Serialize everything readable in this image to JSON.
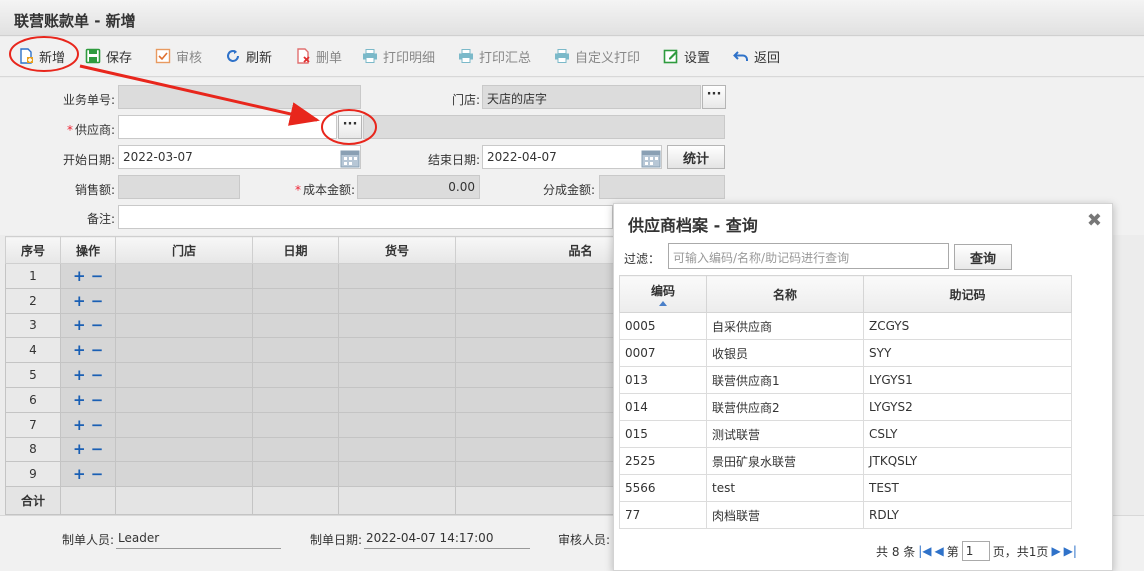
{
  "page": {
    "title": "联营账款单 - 新增"
  },
  "toolbar": {
    "new": "新增",
    "save": "保存",
    "review": "审核",
    "refresh": "刷新",
    "delete": "删单",
    "print_detail": "打印明细",
    "print_summary": "打印汇总",
    "custom_print": "自定义打印",
    "settings": "设置",
    "back": "返回"
  },
  "form": {
    "doc_no_label": "业务单号:",
    "store_label": "门店:",
    "store_value": "天店的店字",
    "supplier_label": "供应商:",
    "start_date_label": "开始日期:",
    "start_date_value": "2022-03-07",
    "end_date_label": "结束日期:",
    "end_date_value": "2022-04-07",
    "stat_button": "统计",
    "sales_label": "销售额:",
    "cost_label": "成本金额:",
    "cost_value": "0.00",
    "share_label": "分成金额:",
    "remark_label": "备注:",
    "dots": "···"
  },
  "grid": {
    "columns": [
      "序号",
      "操作",
      "门店",
      "日期",
      "货号",
      "品名"
    ],
    "rows": [
      "1",
      "2",
      "3",
      "4",
      "5",
      "6",
      "7",
      "8",
      "9"
    ],
    "ops": "+ −",
    "sum_label": "合计"
  },
  "footer": {
    "creator_label": "制单人员:",
    "creator_value": "Leader",
    "date_label": "制单日期:",
    "date_value": "2022-04-07 14:17:00",
    "reviewer_label": "审核人员:"
  },
  "dialog": {
    "title": "供应商档案 - 查询",
    "close": "✖",
    "filter_label": "过滤：",
    "filter_placeholder": "可输入编码/名称/助记码进行查询",
    "query_button": "查询",
    "columns": [
      "编码",
      "名称",
      "助记码"
    ],
    "rows": [
      [
        "0005",
        "自采供应商",
        "ZCGYS"
      ],
      [
        "0007",
        "收银员",
        "SYY"
      ],
      [
        "013",
        "联营供应商1",
        "LYGYS1"
      ],
      [
        "014",
        "联营供应商2",
        "LYGYS2"
      ],
      [
        "015",
        "测试联营",
        "CSLY"
      ],
      [
        "2525",
        "景田矿泉水联营",
        "JTKQSLY"
      ],
      [
        "5566",
        "test",
        "TEST"
      ],
      [
        "77",
        "肉档联营",
        "RDLY"
      ]
    ],
    "pager": {
      "total": "共 8 条",
      "page_prefix": "第",
      "page_value": "1",
      "page_suffix": "页，共1页"
    }
  },
  "colors": {
    "accent": "#2f72c9",
    "annotation_red": "#e8261c",
    "required": "#e23333"
  }
}
